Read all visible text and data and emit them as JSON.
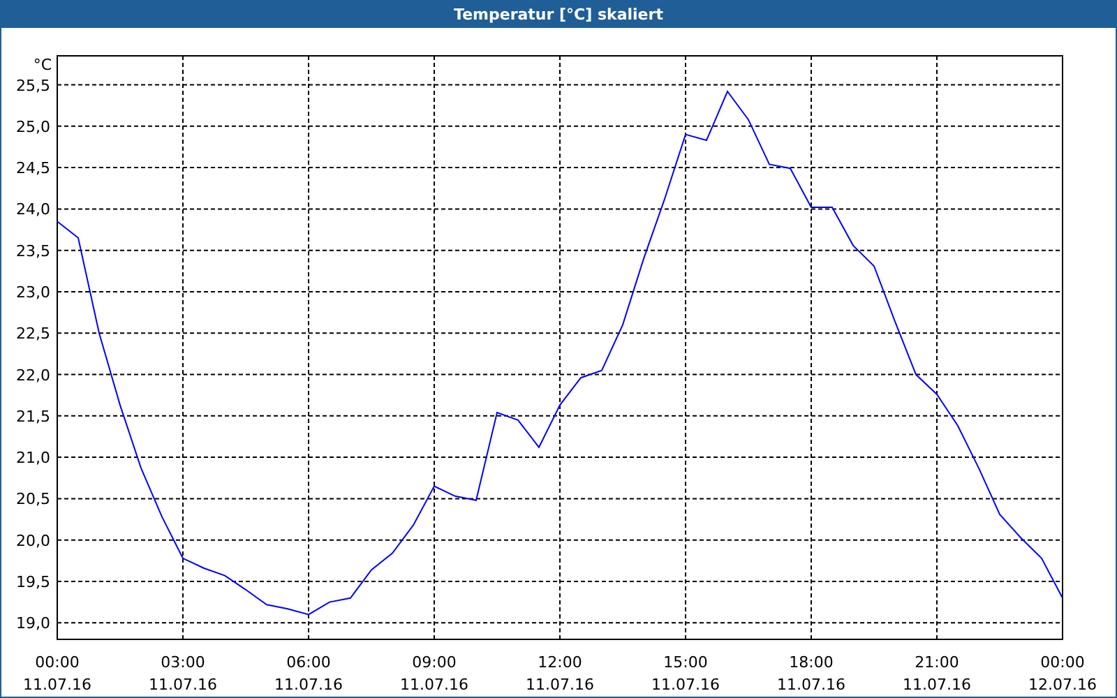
{
  "chart_data": {
    "type": "line",
    "title": "Temperatur [°C] skaliert",
    "ylabel": "°C",
    "ylim": [
      18.8,
      25.85
    ],
    "categories": [
      "00:00\n11.07.16",
      null,
      null,
      null,
      null,
      null,
      "03:00\n11.07.16",
      null,
      null,
      null,
      null,
      null,
      "06:00\n11.07.16",
      null,
      null,
      null,
      null,
      null,
      "09:00\n11.07.16",
      null,
      null,
      null,
      null,
      null,
      "12:00\n11.07.16",
      null,
      null,
      null,
      null,
      null,
      "15:00\n11.07.16",
      null,
      null,
      null,
      null,
      null,
      "18:00\n11.07.16",
      null,
      null,
      null,
      null,
      null,
      "21:00\n11.07.16",
      null,
      null,
      null,
      null,
      null,
      "00:00\n12.07.16"
    ],
    "grid": true,
    "series": [
      {
        "color": "#0000ff",
        "values": [
          23.85,
          23.65,
          22.5,
          21.63,
          20.87,
          20.28,
          19.78,
          19.66,
          19.57,
          19.4,
          19.22,
          19.17,
          19.1,
          19.25,
          19.3,
          19.64,
          19.84,
          20.18,
          20.65,
          20.53,
          20.48,
          21.54,
          21.45,
          21.12,
          21.63,
          21.96,
          22.05,
          22.6,
          23.4,
          24.12,
          24.9,
          24.83,
          25.42,
          25.08,
          24.54,
          24.49,
          24.02,
          24.02,
          23.56,
          23.31,
          22.64,
          22.0,
          21.76,
          21.38,
          20.87,
          20.31,
          20.03,
          19.78,
          19.3
        ]
      }
    ],
    "yticks": [
      {
        "value": 19,
        "label": "19,0"
      },
      {
        "value": 19.5,
        "label": "19,5"
      },
      {
        "value": 20,
        "label": "20,0"
      },
      {
        "value": 20.5,
        "label": "20,5"
      },
      {
        "value": 21,
        "label": "21,0"
      },
      {
        "value": 21.5,
        "label": "21,5"
      },
      {
        "value": 22,
        "label": "22,0"
      },
      {
        "value": 22.5,
        "label": "22,5"
      },
      {
        "value": 23,
        "label": "23,0"
      },
      {
        "value": 23.5,
        "label": "23,5"
      },
      {
        "value": 24,
        "label": "24,0"
      },
      {
        "value": 24.5,
        "label": "24,5"
      },
      {
        "value": 25,
        "label": "25,0"
      },
      {
        "value": 25.5,
        "label": "25,5"
      }
    ]
  }
}
